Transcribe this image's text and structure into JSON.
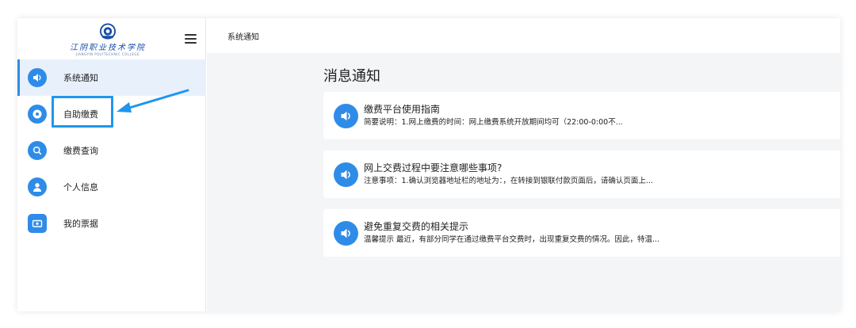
{
  "brand": {
    "logo_cn": "江阴职业技术学院",
    "logo_en": "JIANGYIN POLYTECHNIC COLLEGE"
  },
  "sidebar": {
    "items": [
      {
        "label": "系统通知",
        "icon": "speaker-icon",
        "active": true
      },
      {
        "label": "自助缴费",
        "icon": "disc-icon",
        "active": false
      },
      {
        "label": "缴费查询",
        "icon": "search-icon",
        "active": false
      },
      {
        "label": "个人信息",
        "icon": "user-icon",
        "active": false
      },
      {
        "label": "我的票据",
        "icon": "ticket-icon",
        "active": false
      }
    ]
  },
  "header": {
    "breadcrumb": "系统通知"
  },
  "main": {
    "title": "消息通知",
    "notices": [
      {
        "title": "缴费平台使用指南",
        "desc": "简要说明：1.网上缴费的时间：网上缴费系统开放期间均可（22:00-0:00不..."
      },
      {
        "title": "网上交费过程中要注意哪些事项?",
        "desc": "注意事项：1.确认浏览器地址栏的地址为：，在转接到银联付款页面后，请确认页面上..."
      },
      {
        "title": "避免重复交费的相关提示",
        "desc": "温馨提示 最近，有部分同学在通过缴费平台交费时，出现重复交费的情况。因此，特温..."
      }
    ]
  },
  "colors": {
    "accent": "#2e8ce8",
    "highlight": "#1e96ee",
    "active_bg": "#e8f1fb",
    "main_bg": "#f4f5f7"
  }
}
